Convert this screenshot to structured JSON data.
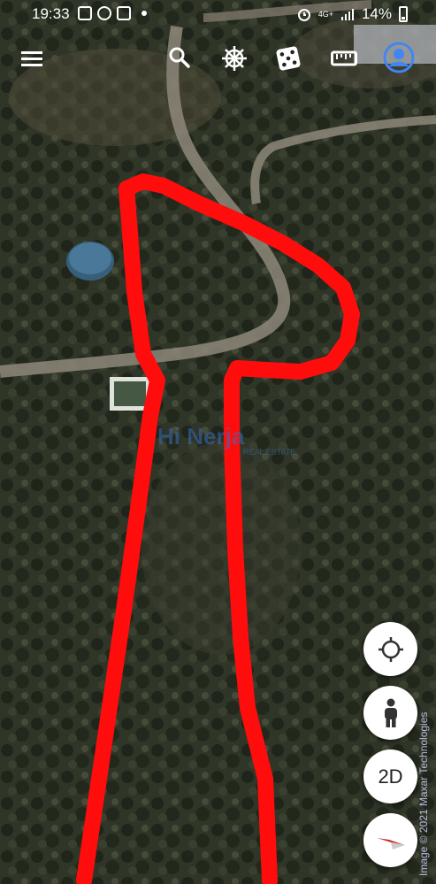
{
  "status_bar": {
    "time": "19:33",
    "network": "4G+",
    "battery": "14%"
  },
  "toolbar": {
    "menu_icon": "hamburger-menu-icon",
    "search_icon": "search-icon",
    "voyager_icon": "ship-wheel-icon",
    "feeling_lucky_icon": "dice-icon",
    "measure_icon": "ruler-icon",
    "account_icon": "account-icon"
  },
  "map": {
    "watermark": "Hi Nerja",
    "watermark_sub": "REAL ESTATE",
    "copyright": "Image © 2021 Maxar Technologies"
  },
  "controls": {
    "location_icon": "crosshair-icon",
    "street_view_icon": "pegman-icon",
    "view_mode_label": "2D",
    "compass_icon": "compass-icon"
  },
  "colors": {
    "outline": "#ff0d0d",
    "accent": "#4285f4"
  }
}
